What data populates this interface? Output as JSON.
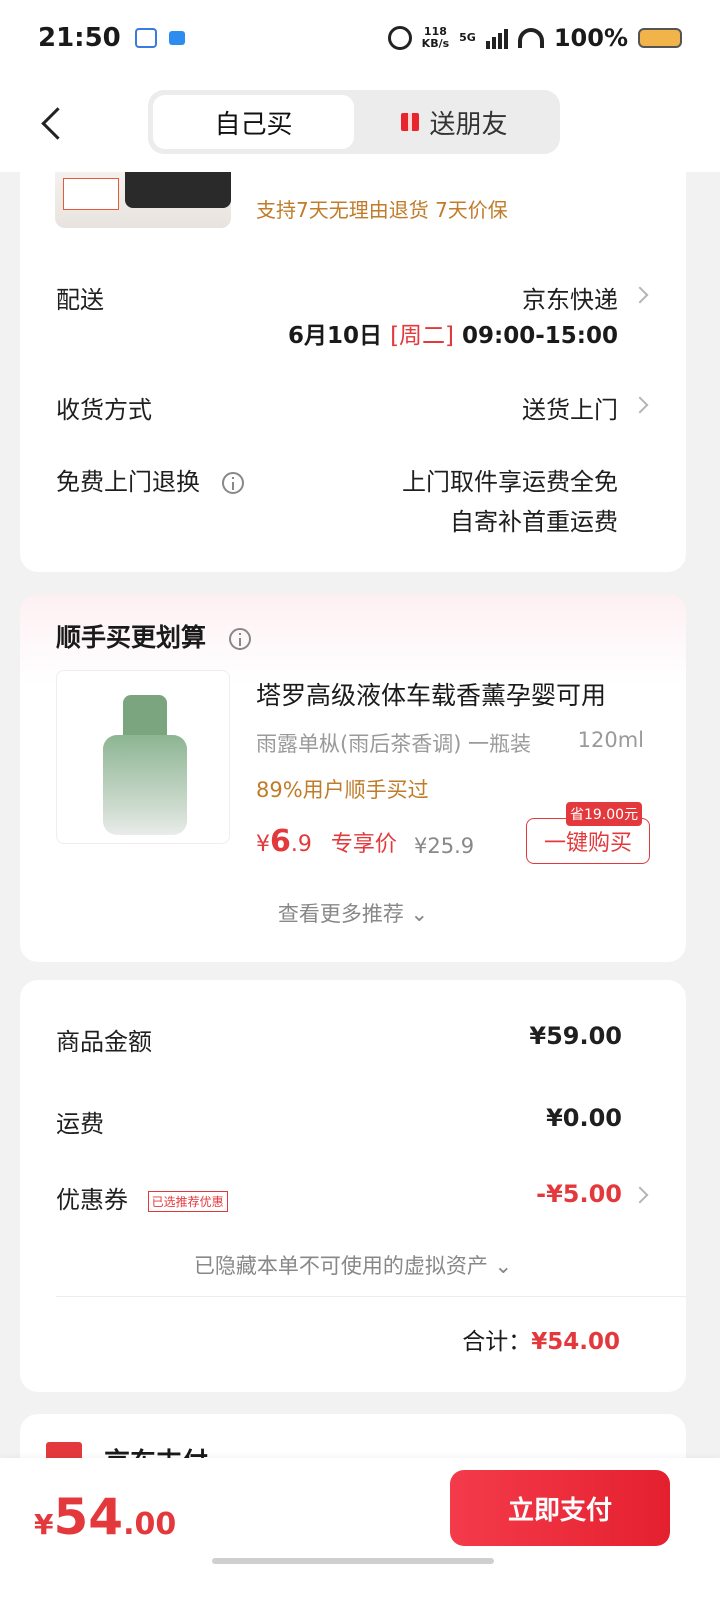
{
  "status_bar": {
    "time": "21:50",
    "net_speed_value": "118",
    "net_speed_unit": "KB/s",
    "network": "5G",
    "battery": "100%"
  },
  "header": {
    "tabs": [
      {
        "label": "自己买",
        "active": true
      },
      {
        "label": "送朋友",
        "active": false
      }
    ]
  },
  "product": {
    "services": "支持7天无理由退货  7天价保"
  },
  "delivery": {
    "label": "配送",
    "carrier": "京东快递",
    "date": "6月10日",
    "weekday": "[周二]",
    "time_window": "09:00-15:00"
  },
  "receive": {
    "label": "收货方式",
    "value": "送货上门"
  },
  "returns": {
    "label": "免费上门退换",
    "line1": "上门取件享运费全免",
    "line2": "自寄补首重运费"
  },
  "recommend": {
    "title": "顺手买更划算",
    "item_title": "塔罗高级液体车载香薰孕婴可用",
    "spec": "雨露单枞(雨后茶香调) 一瓶装",
    "volume": "120ml",
    "stat": "89%用户顺手买过",
    "price_symbol": "¥",
    "price_int": "6",
    "price_dec": ".9",
    "price_tag": "专享价",
    "original_price": "¥25.9",
    "save_badge": "省19.00元",
    "buy_label": "一键购买",
    "more_label": "查看更多推荐"
  },
  "fees": {
    "goods_label": "商品金额",
    "goods_value": "¥59.00",
    "shipping_label": "运费",
    "shipping_value": "¥0.00",
    "coupon_label": "优惠券",
    "coupon_tag": "已选推荐优惠",
    "coupon_value": "-¥5.00",
    "hidden_assets": "已隐藏本单不可使用的虚拟资产",
    "total_label": "合计：",
    "total_value": "¥54.00"
  },
  "payment": {
    "method": "京东支付"
  },
  "bottom": {
    "currency": "¥",
    "amount_int": "54",
    "amount_dec": ".00",
    "pay_button": "立即支付"
  },
  "colors": {
    "accent": "#e4393c",
    "orange_text": "#c07c2a"
  }
}
